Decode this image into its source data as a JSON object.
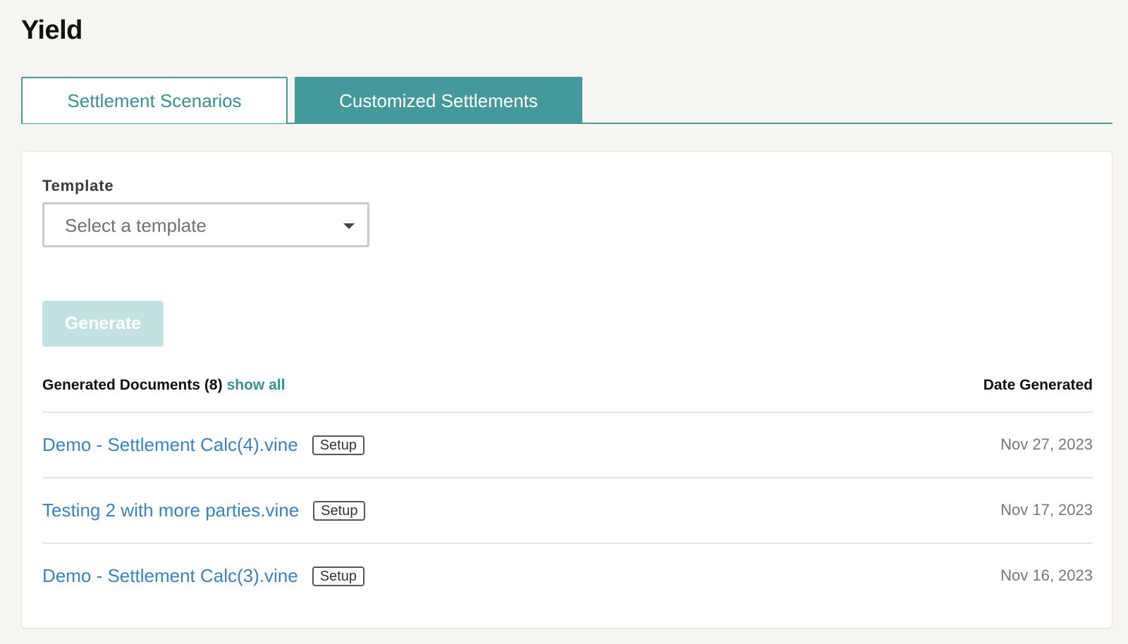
{
  "page": {
    "title": "Yield"
  },
  "tabs": [
    {
      "label": "Settlement Scenarios",
      "active": false
    },
    {
      "label": "Customized Settlements",
      "active": true
    }
  ],
  "template": {
    "label": "Template",
    "placeholder": "Select a template",
    "caret_icon": "caret-down-icon"
  },
  "generate": {
    "label": "Generate",
    "enabled": false
  },
  "documents": {
    "heading": "Generated Documents (8)",
    "show_all": "show all",
    "date_heading": "Date Generated",
    "rows": [
      {
        "name": "Demo - Settlement Calc(4).vine",
        "badge": "Setup",
        "date": "Nov 27, 2023"
      },
      {
        "name": "Testing 2 with more parties.vine",
        "badge": "Setup",
        "date": "Nov 17, 2023"
      },
      {
        "name": "Demo - Settlement Calc(3).vine",
        "badge": "Setup",
        "date": "Nov 16, 2023"
      }
    ]
  },
  "colors": {
    "accent": "#45999a",
    "link": "#3a82c0",
    "disabled_button": "#c4e1e2",
    "background": "#f7f6f2"
  }
}
